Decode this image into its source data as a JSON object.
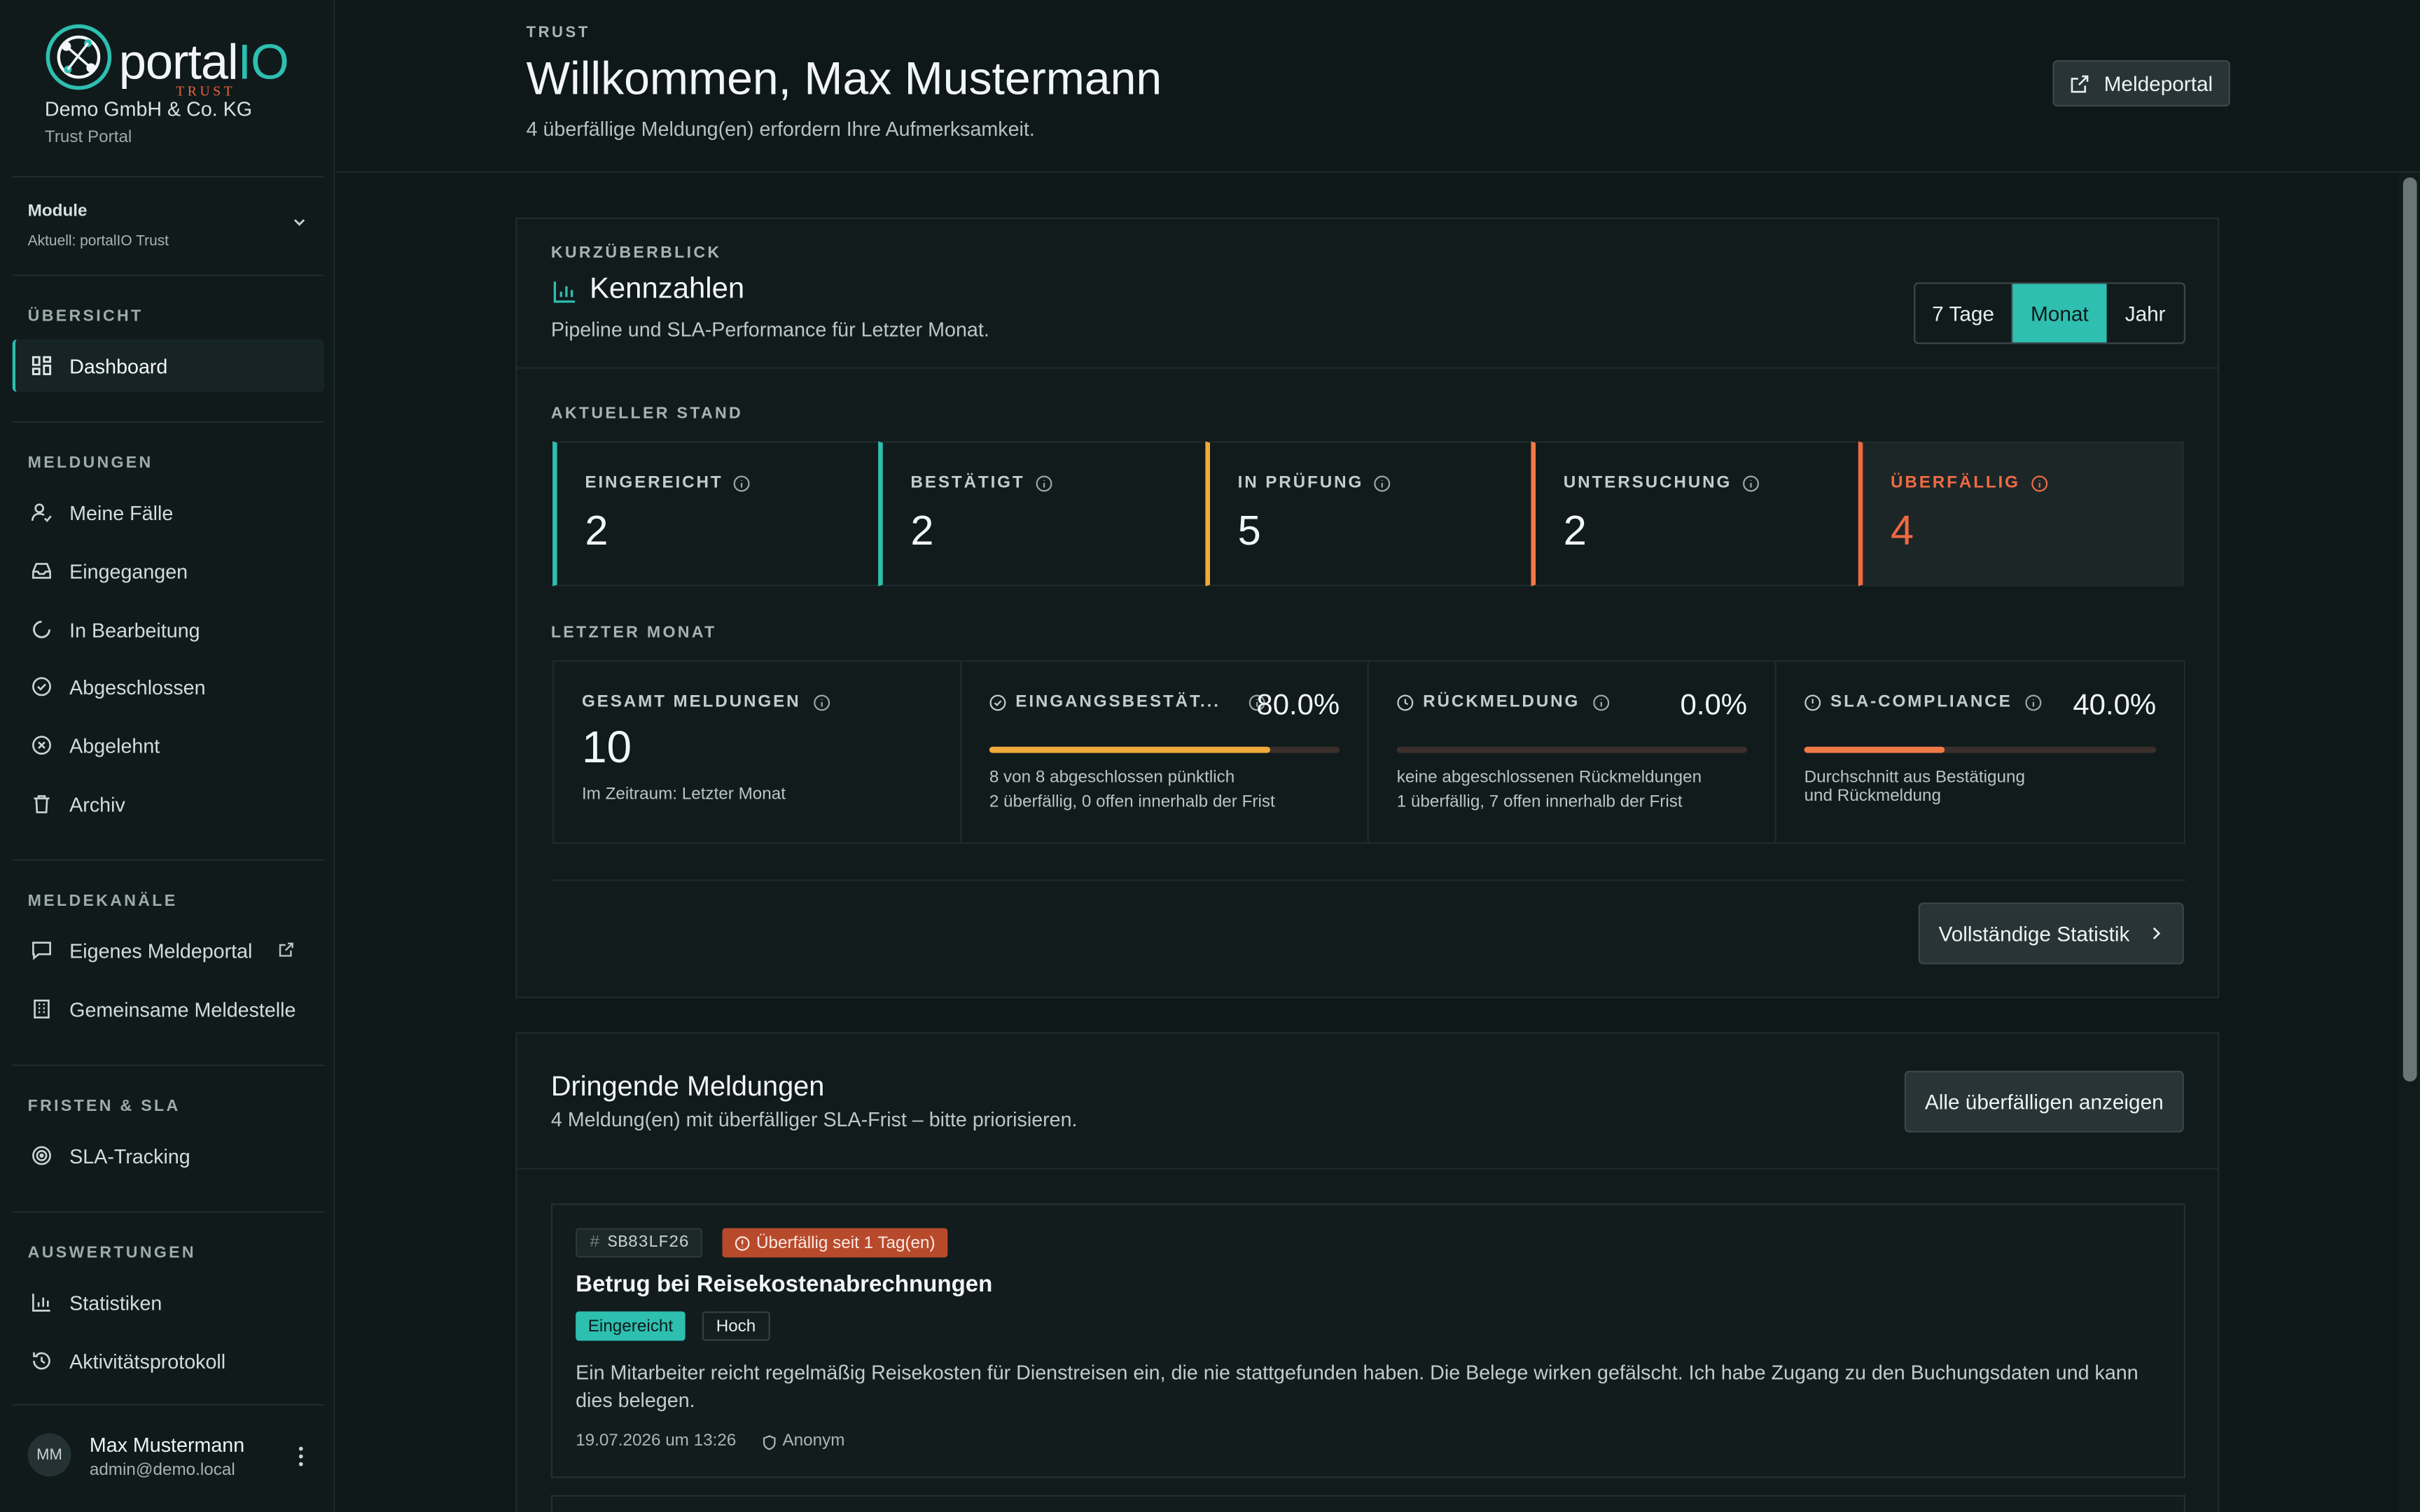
{
  "brand": {
    "name_main": "portal",
    "name_accent": "IO",
    "sub": "TRUST",
    "company": "Demo GmbH & Co. KG",
    "portal": "Trust Portal"
  },
  "module": {
    "title": "Module",
    "current": "Aktuell: portalIO Trust"
  },
  "sidebar": {
    "sections": {
      "overview": "ÜBERSICHT",
      "reports": "MELDUNGEN",
      "channels": "MELDEKANÄLE",
      "sla": "FRISTEN & SLA",
      "analytics": "AUSWERTUNGEN"
    },
    "items": {
      "dashboard": "Dashboard",
      "my_cases": "Meine Fälle",
      "inbox": "Eingegangen",
      "in_progress": "In Bearbeitung",
      "closed": "Abgeschlossen",
      "rejected": "Abgelehnt",
      "archive": "Archiv",
      "own_portal": "Eigenes Meldeportal",
      "shared_office": "Gemeinsame Meldestelle",
      "sla_tracking": "SLA-Tracking",
      "statistics": "Statistiken",
      "activity_log": "Aktivitätsprotokoll"
    }
  },
  "user": {
    "initials": "MM",
    "name": "Max Mustermann",
    "email": "admin@demo.local"
  },
  "header": {
    "eyebrow": "TRUST",
    "title": "Willkommen, Max Mustermann",
    "subtitle": "4 überfällige Meldung(en) erfordern Ihre Aufmerksamkeit.",
    "portal_button": "Meldeportal"
  },
  "kpi_card": {
    "eyebrow": "KURZÜBERBLICK",
    "title": "Kennzahlen",
    "subtitle": "Pipeline und SLA-Performance für Letzter Monat.",
    "periods": [
      "7 Tage",
      "Monat",
      "Jahr"
    ],
    "selected_period": "Monat",
    "current_label": "AKTUELLER STAND",
    "stats": [
      {
        "label": "EINGEREICHT",
        "value": "2",
        "color": "#2dbfb0"
      },
      {
        "label": "BESTÄTIGT",
        "value": "2",
        "color": "#2dbfb0"
      },
      {
        "label": "IN PRÜFUNG",
        "value": "5",
        "color": "#f2a93b"
      },
      {
        "label": "UNTERSUCHUNG",
        "value": "2",
        "color": "#f07a45"
      },
      {
        "label": "ÜBERFÄLLIG",
        "value": "4",
        "color": "#ef6a43"
      }
    ],
    "last_month_label": "LETZTER MONAT",
    "total": {
      "label": "GESAMT MELDUNGEN",
      "value": "10",
      "note": "Im Zeitraum: Letzter Monat"
    },
    "metrics": [
      {
        "label": "EINGANGSBESTÄT...",
        "pct": "80.0%",
        "progress": 0.8,
        "color": "#f2a93b",
        "line1": "8 von 8 abgeschlossen pünktlich",
        "line2": "2 überfällig, 0 offen innerhalb der Frist"
      },
      {
        "label": "RÜCKMELDUNG",
        "pct": "0.0%",
        "progress": 0.0,
        "color": "#f07a45",
        "line1": "keine abgeschlossenen Rückmeldungen",
        "line2": "1 überfällig, 7 offen innerhalb der Frist"
      },
      {
        "label": "SLA-COMPLIANCE",
        "pct": "40.0%",
        "progress": 0.4,
        "color": "#f07a45",
        "line1": "Durchschnitt aus Bestätigung",
        "line2": "und Rückmeldung"
      }
    ],
    "full_stats_button": "Vollständige Statistik"
  },
  "urgent": {
    "title": "Dringende Meldungen",
    "subtitle": "4 Meldung(en) mit überfälliger SLA-Frist – bitte priorisieren.",
    "show_all_button": "Alle überfälligen anzeigen",
    "items": [
      {
        "id": "SB83LF26",
        "overdue": "Überfällig seit 1 Tag(en)",
        "title": "Betrug bei Reisekostenabrechnungen",
        "status": "Eingereicht",
        "priority": "Hoch",
        "text": "Ein Mitarbeiter reicht regelmäßig Reisekosten für Dienstreisen ein, die nie stattgefunden haben. Die Belege wirken gefälscht. Ich habe Zugang zu den Buchungsdaten und kann dies belegen.",
        "date": "19.07.2026 um 13:26",
        "reporter": "Anonym"
      }
    ]
  }
}
